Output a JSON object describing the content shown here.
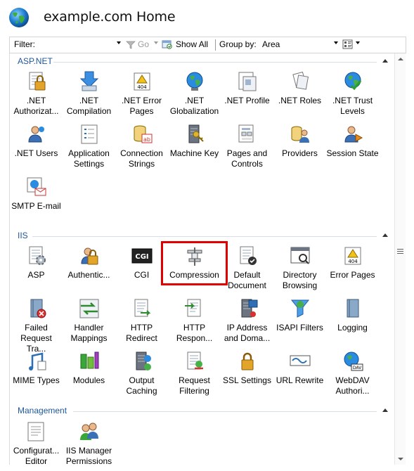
{
  "header": {
    "title": "example.com Home"
  },
  "filterbar": {
    "filter_label": "Filter:",
    "go_label": "Go",
    "show_all_label": "Show All",
    "group_by_label": "Group by:",
    "group_by_value": "Area"
  },
  "groups": {
    "aspnet": {
      "title": "ASP.NET",
      "items": [
        {
          "label": ".NET Authorizat...",
          "icon": "net-authorization-icon"
        },
        {
          "label": ".NET Compilation",
          "icon": "net-compilation-icon"
        },
        {
          "label": ".NET Error Pages",
          "icon": "net-error-pages-icon"
        },
        {
          "label": ".NET Globalization",
          "icon": "net-globalization-icon"
        },
        {
          "label": ".NET Profile",
          "icon": "net-profile-icon"
        },
        {
          "label": ".NET Roles",
          "icon": "net-roles-icon"
        },
        {
          "label": ".NET Trust Levels",
          "icon": "net-trust-levels-icon"
        },
        {
          "label": ".NET Users",
          "icon": "net-users-icon"
        },
        {
          "label": "Application Settings",
          "icon": "application-settings-icon"
        },
        {
          "label": "Connection Strings",
          "icon": "connection-strings-icon"
        },
        {
          "label": "Machine Key",
          "icon": "machine-key-icon"
        },
        {
          "label": "Pages and Controls",
          "icon": "pages-and-controls-icon"
        },
        {
          "label": "Providers",
          "icon": "providers-icon"
        },
        {
          "label": "Session State",
          "icon": "session-state-icon"
        },
        {
          "label": "SMTP E-mail",
          "icon": "smtp-email-icon"
        }
      ]
    },
    "iis": {
      "title": "IIS",
      "items": [
        {
          "label": "ASP",
          "icon": "asp-icon"
        },
        {
          "label": "Authentic...",
          "icon": "authentication-icon"
        },
        {
          "label": "CGI",
          "icon": "cgi-icon"
        },
        {
          "label": "Compression",
          "icon": "compression-icon"
        },
        {
          "label": "Default Document",
          "icon": "default-document-icon"
        },
        {
          "label": "Directory Browsing",
          "icon": "directory-browsing-icon"
        },
        {
          "label": "Error Pages",
          "icon": "error-pages-icon"
        },
        {
          "label": "Failed Request Tra...",
          "icon": "failed-request-tracing-icon"
        },
        {
          "label": "Handler Mappings",
          "icon": "handler-mappings-icon"
        },
        {
          "label": "HTTP Redirect",
          "icon": "http-redirect-icon"
        },
        {
          "label": "HTTP Respon...",
          "icon": "http-response-headers-icon"
        },
        {
          "label": "IP Address and Doma...",
          "icon": "ip-address-domain-icon"
        },
        {
          "label": "ISAPI Filters",
          "icon": "isapi-filters-icon"
        },
        {
          "label": "Logging",
          "icon": "logging-icon"
        },
        {
          "label": "MIME Types",
          "icon": "mime-types-icon"
        },
        {
          "label": "Modules",
          "icon": "modules-icon"
        },
        {
          "label": "Output Caching",
          "icon": "output-caching-icon"
        },
        {
          "label": "Request Filtering",
          "icon": "request-filtering-icon"
        },
        {
          "label": "SSL Settings",
          "icon": "ssl-settings-icon"
        },
        {
          "label": "URL Rewrite",
          "icon": "url-rewrite-icon"
        },
        {
          "label": "WebDAV Authori...",
          "icon": "webdav-authoring-icon"
        }
      ]
    },
    "management": {
      "title": "Management",
      "items": [
        {
          "label": "Configurat... Editor",
          "icon": "configuration-editor-icon"
        },
        {
          "label": "IIS Manager Permissions",
          "icon": "iis-manager-permissions-icon"
        }
      ]
    }
  },
  "highlight": {
    "target": "Compression",
    "color": "#e00000"
  },
  "colors": {
    "group_title": "#1e5799",
    "group_line": "#d5dfe5"
  }
}
